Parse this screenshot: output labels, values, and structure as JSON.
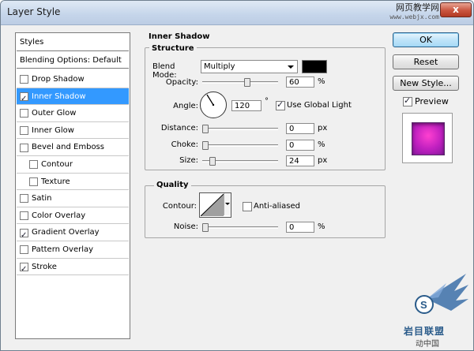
{
  "window": {
    "title": "Layer Style",
    "close_glyph": "x"
  },
  "watermark": {
    "top": "网页教学网",
    "top_sub": "www.webjx.com",
    "bottom": "岩目联盟",
    "bottom2": "动中国"
  },
  "left_panel": {
    "styles_label": "Styles",
    "blending_label": "Blending Options: Default",
    "items": [
      {
        "label": "Drop Shadow",
        "checked": false,
        "indent": false,
        "selected": false
      },
      {
        "label": "Inner Shadow",
        "checked": true,
        "indent": false,
        "selected": true
      },
      {
        "label": "Outer Glow",
        "checked": false,
        "indent": false,
        "selected": false
      },
      {
        "label": "Inner Glow",
        "checked": false,
        "indent": false,
        "selected": false
      },
      {
        "label": "Bevel and Emboss",
        "checked": false,
        "indent": false,
        "selected": false
      },
      {
        "label": "Contour",
        "checked": false,
        "indent": true,
        "selected": false
      },
      {
        "label": "Texture",
        "checked": false,
        "indent": true,
        "selected": false
      },
      {
        "label": "Satin",
        "checked": false,
        "indent": false,
        "selected": false
      },
      {
        "label": "Color Overlay",
        "checked": false,
        "indent": false,
        "selected": false
      },
      {
        "label": "Gradient Overlay",
        "checked": true,
        "indent": false,
        "selected": false
      },
      {
        "label": "Pattern Overlay",
        "checked": false,
        "indent": false,
        "selected": false
      },
      {
        "label": "Stroke",
        "checked": true,
        "indent": false,
        "selected": false
      }
    ]
  },
  "inner_shadow": {
    "section_title": "Inner Shadow",
    "structure_title": "Structure",
    "blend_mode": {
      "label": "Blend Mode:",
      "value": "Multiply",
      "color": "#000000"
    },
    "opacity": {
      "label": "Opacity:",
      "value": "60",
      "unit": "%",
      "level": 0.6
    },
    "angle": {
      "label": "Angle:",
      "value": "120",
      "unit": "°",
      "global_light_label": "Use Global Light",
      "global_light_checked": true
    },
    "distance": {
      "label": "Distance:",
      "value": "0",
      "unit": "px",
      "level": 0
    },
    "choke": {
      "label": "Choke:",
      "value": "0",
      "unit": "%",
      "level": 0
    },
    "size": {
      "label": "Size:",
      "value": "24",
      "unit": "px",
      "level": 0.097
    },
    "quality_title": "Quality",
    "contour_label": "Contour:",
    "anti_aliased_label": "Anti-aliased",
    "anti_aliased_checked": false,
    "noise": {
      "label": "Noise:",
      "value": "0",
      "unit": "%",
      "level": 0
    }
  },
  "buttons": {
    "ok": "OK",
    "reset": "Reset",
    "new_style": "New Style...",
    "preview_label": "Preview",
    "preview_checked": true
  }
}
